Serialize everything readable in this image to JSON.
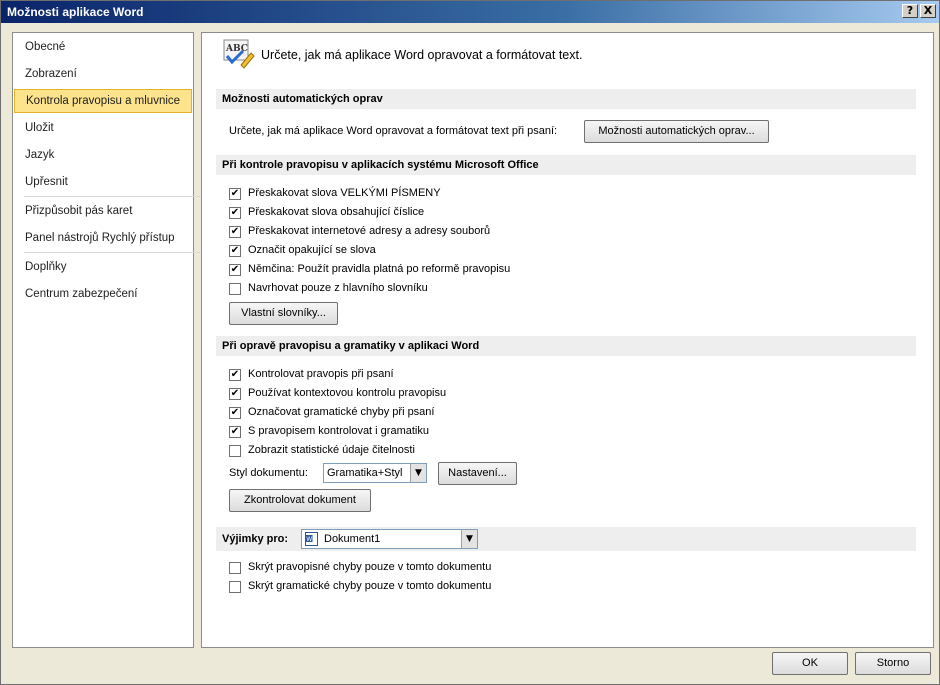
{
  "window": {
    "title": "Možnosti aplikace Word",
    "help_label": "?",
    "close_label": "X"
  },
  "nav": {
    "items": [
      {
        "label": "Obecné"
      },
      {
        "label": "Zobrazení"
      },
      {
        "label": "Kontrola pravopisu a mluvnice",
        "selected": true
      },
      {
        "label": "Uložit"
      },
      {
        "label": "Jazyk"
      },
      {
        "label": "Upřesnit"
      },
      {
        "label": "Přizpůsobit pás karet"
      },
      {
        "label": "Panel nástrojů Rychlý přístup"
      },
      {
        "label": "Doplňky"
      },
      {
        "label": "Centrum zabezpečení"
      }
    ]
  },
  "header": {
    "icon": "abc-check-icon",
    "icon_text": "ABC",
    "text": "Určete, jak má aplikace Word opravovat a formátovat text."
  },
  "autocorrect": {
    "title": "Možnosti automatických oprav",
    "desc": "Určete, jak má aplikace Word opravovat a formátovat text při psaní:",
    "button": "Možnosti automatických oprav..."
  },
  "office_spelling": {
    "title": "Při kontrole pravopisu v aplikacích systému Microsoft Office",
    "options": [
      {
        "label": "Přeskakovat slova VELKÝMI PÍSMENY",
        "checked": true
      },
      {
        "label": "Přeskakovat slova obsahující číslice",
        "checked": true
      },
      {
        "label": "Přeskakovat internetové adresy a adresy souborů",
        "checked": true
      },
      {
        "label": "Označit opakující se slova",
        "checked": true
      },
      {
        "label": "Němčina: Použít pravidla platná po reformě pravopisu",
        "checked": true
      },
      {
        "label": "Navrhovat pouze z hlavního slovníku",
        "checked": false
      }
    ],
    "custom_dicts_button": "Vlastní slovníky..."
  },
  "word_spelling": {
    "title": "Při opravě pravopisu a gramatiky v aplikaci Word",
    "options": [
      {
        "label": "Kontrolovat pravopis při psaní",
        "checked": true
      },
      {
        "label": "Používat kontextovou kontrolu pravopisu",
        "checked": true
      },
      {
        "label": "Označovat gramatické chyby při psaní",
        "checked": true
      },
      {
        "label": "S pravopisem kontrolovat i gramatiku",
        "checked": true
      },
      {
        "label": "Zobrazit statistické údaje čitelnosti",
        "checked": false
      }
    ],
    "style_label": "Styl dokumentu:",
    "style_value": "Gramatika+Styl",
    "settings_button": "Nastavení...",
    "check_doc_button": "Zkontrolovat dokument"
  },
  "exceptions": {
    "label": "Výjimky pro:",
    "doc_icon": "word-document-icon",
    "doc_value": "Dokument1",
    "options": [
      {
        "label": "Skrýt pravopisné chyby pouze v tomto dokumentu",
        "checked": false
      },
      {
        "label": "Skrýt gramatické chyby pouze v tomto dokumentu",
        "checked": false
      }
    ]
  },
  "footer": {
    "ok": "OK",
    "cancel": "Storno"
  },
  "colors": {
    "selected_bg": "#fde38b",
    "selected_border": "#e2b22d",
    "section_bg": "#eeeeee"
  }
}
